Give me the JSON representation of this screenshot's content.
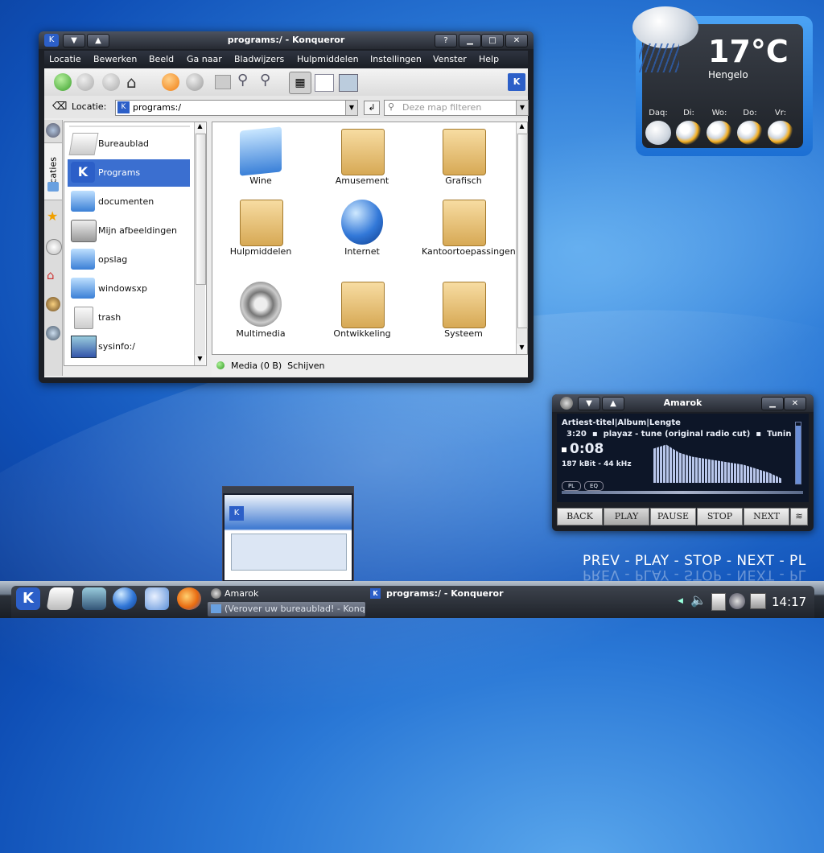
{
  "konqueror": {
    "title": "programs:/ - Konqueror",
    "menu": [
      "Locatie",
      "Bewerken",
      "Beeld",
      "Ga naar",
      "Bladwijzers",
      "Hulpmiddelen",
      "Instellingen",
      "Venster",
      "Help"
    ],
    "location_label": "Locatie:",
    "location_value": "programs:/",
    "filter_placeholder": "Deze map filteren",
    "sidebar_tab_label": "locaties",
    "places": [
      {
        "label": "Bureaublad",
        "selected": false
      },
      {
        "label": "Programs",
        "selected": true
      },
      {
        "label": "documenten",
        "selected": false
      },
      {
        "label": "Mijn afbeeldingen",
        "selected": false
      },
      {
        "label": "opslag",
        "selected": false
      },
      {
        "label": "windowsxp",
        "selected": false
      },
      {
        "label": "trash",
        "selected": false
      },
      {
        "label": "sysinfo:/",
        "selected": false
      }
    ],
    "files": [
      {
        "label": "Wine",
        "icon": "wine-folder-icon"
      },
      {
        "label": "Amusement",
        "icon": "joystick-folder-icon"
      },
      {
        "label": "Grafisch",
        "icon": "graphics-folder-icon"
      },
      {
        "label": "Hulpmiddelen",
        "icon": "utilities-folder-icon"
      },
      {
        "label": "Internet",
        "icon": "globe-icon"
      },
      {
        "label": "Kantoortoepassingen",
        "icon": "office-folder-icon"
      },
      {
        "label": "Multimedia",
        "icon": "speaker-icon"
      },
      {
        "label": "Ontwikkeling",
        "icon": "development-folder-icon"
      },
      {
        "label": "Systeem",
        "icon": "system-folder-icon"
      }
    ],
    "status": "Media (0 B)  Schijven",
    "help_btn": "?"
  },
  "weather": {
    "temperature": "17°C",
    "city": "Hengelo",
    "days": [
      "Daq:",
      "Di:",
      "Wo:",
      "Do:",
      "Vr:"
    ]
  },
  "amarok": {
    "title": "Amarok",
    "header": "Artiest-titel|Album|Lengte",
    "ticker": "3:20  ▪  playaz - tune (original radio cut)  ▪  Tunin",
    "time": "0:08",
    "bitrate": "187 kBit - 44 kHz",
    "pl": "PL",
    "eq": "EQ",
    "buttons": [
      "BACK",
      "PLAY",
      "PAUSE",
      "STOP",
      "NEXT"
    ]
  },
  "desktop_controls": "PREV - PLAY - STOP - NEXT - PL",
  "taskbar": {
    "tasks": [
      {
        "label": "Amarok"
      },
      {
        "label": "programs:/ - Konqueror"
      },
      {
        "label": "(Verover uw bureaublad! - Konq"
      }
    ],
    "clock": "14:17"
  }
}
